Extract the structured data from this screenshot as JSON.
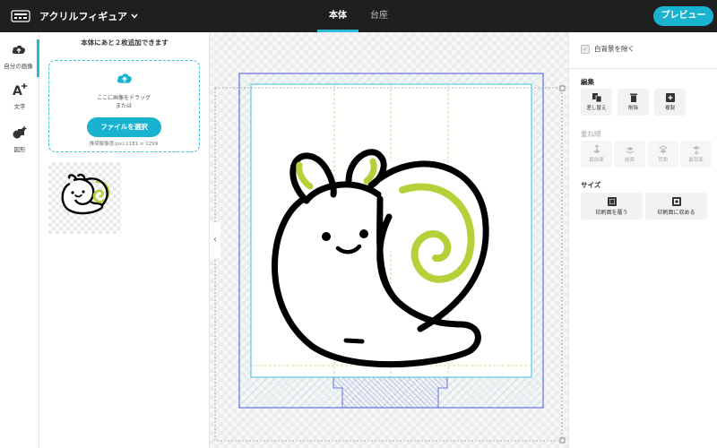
{
  "header": {
    "product_label": "アクリルフィギュア",
    "tabs": [
      {
        "label": "本体",
        "active": true
      },
      {
        "label": "台座",
        "active": false
      }
    ],
    "preview_label": "プレビュー"
  },
  "rail": {
    "items": [
      {
        "label": "自分の画像",
        "icon": "cloud-upload-icon",
        "active": true
      },
      {
        "label": "文字",
        "icon": "text-add-icon",
        "active": false
      },
      {
        "label": "図形",
        "icon": "shapes-add-icon",
        "active": false
      }
    ]
  },
  "upload_panel": {
    "remaining_text": "本体にあと２枚追加できます",
    "drop_text": "ここに画像をドラッグ",
    "or_text": "または",
    "select_button": "ファイルを選択",
    "resolution_text": "推奨解像度(px):1181 × 1299"
  },
  "right_panel": {
    "remove_bg_label": "白背景を除く",
    "edit_title": "編集",
    "edit_tools": [
      {
        "label": "差し替え",
        "icon": "replace-icon"
      },
      {
        "label": "削除",
        "icon": "trash-icon"
      },
      {
        "label": "複製",
        "icon": "duplicate-icon"
      }
    ],
    "layer_title": "重ね順",
    "layer_tools": [
      {
        "label": "最前面",
        "icon": "bring-front-icon"
      },
      {
        "label": "前面",
        "icon": "bring-forward-icon"
      },
      {
        "label": "背面",
        "icon": "send-backward-icon"
      },
      {
        "label": "最背面",
        "icon": "send-back-icon"
      }
    ],
    "size_title": "サイズ",
    "size_tools": [
      {
        "label": "印刷面を覆う",
        "icon": "fill-print-icon"
      },
      {
        "label": "印刷面に収める",
        "icon": "fit-print-icon"
      }
    ]
  },
  "colors": {
    "accent": "#19b3cf",
    "topbar": "#1f1f1f",
    "guide_blue": "#4a55d6",
    "snail_green": "#b5d13a"
  }
}
